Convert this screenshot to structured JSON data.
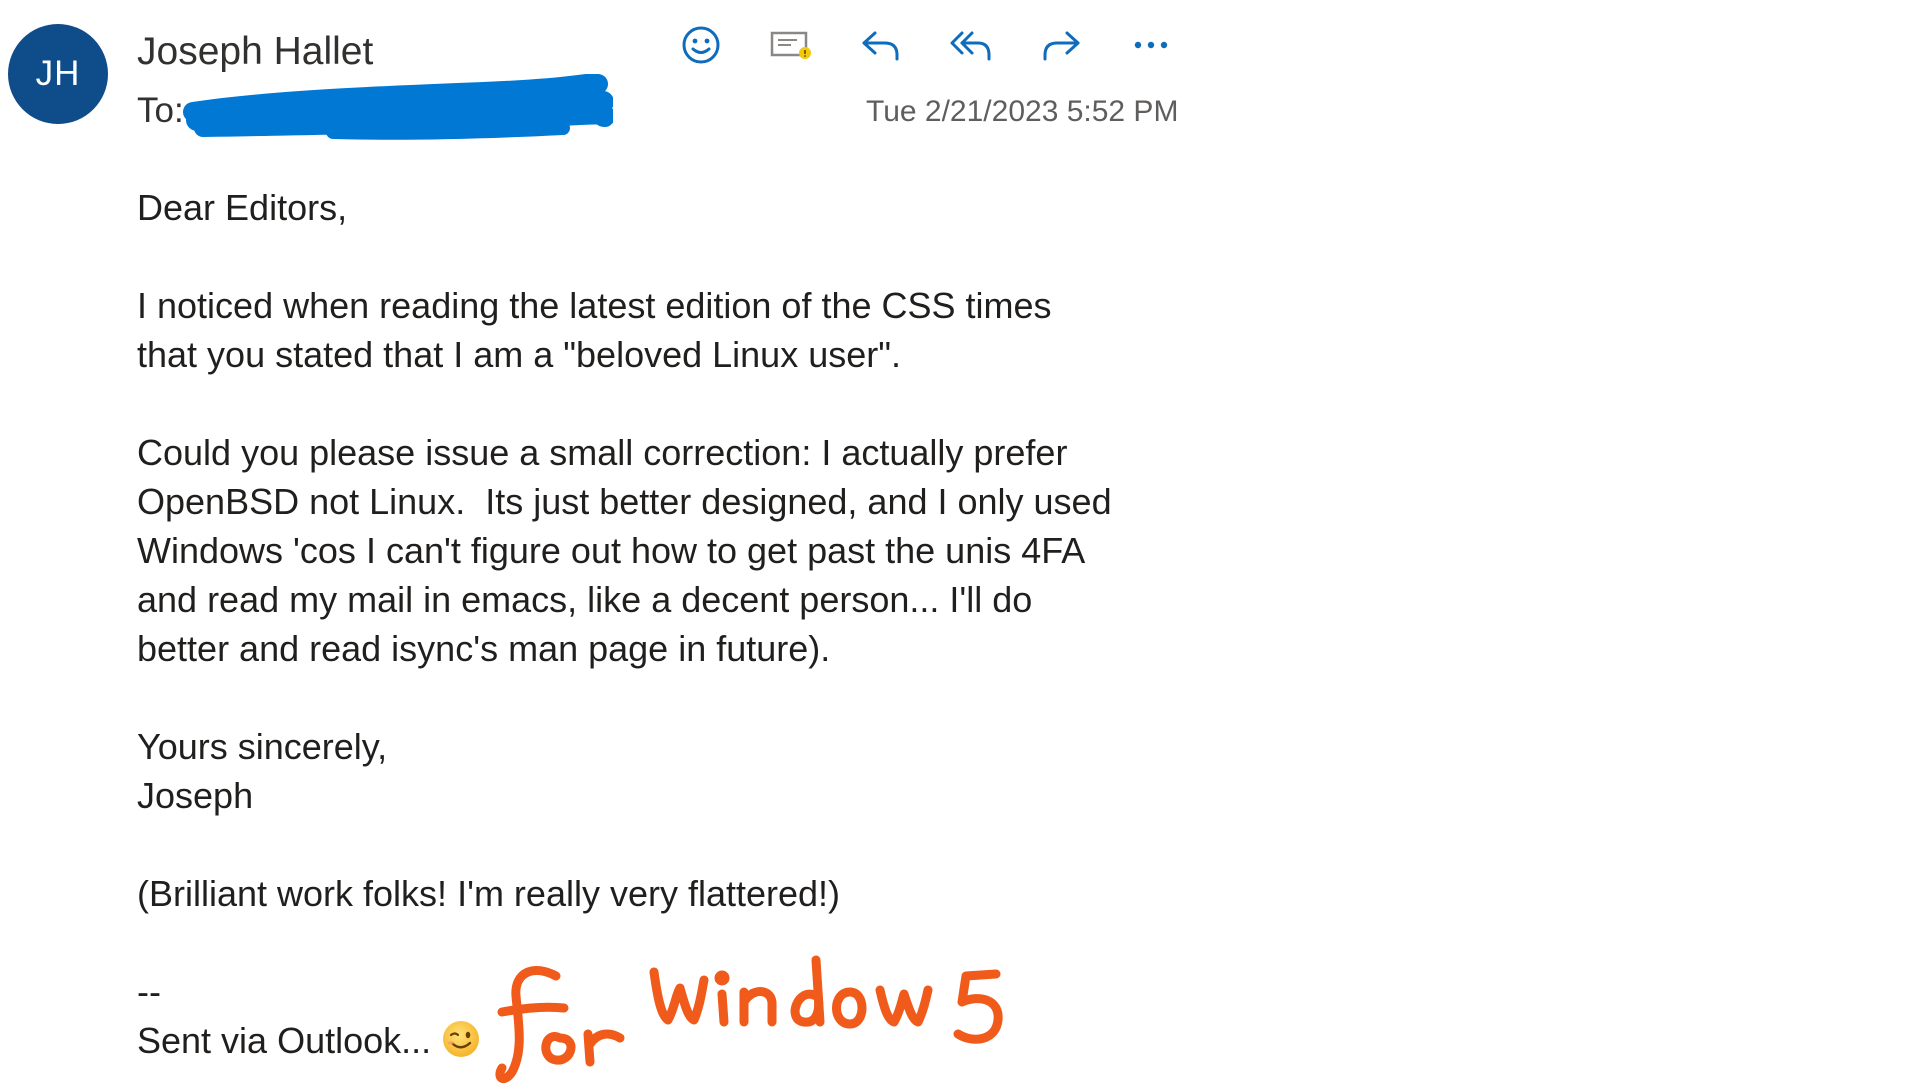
{
  "header": {
    "avatar_initials": "JH",
    "sender_name": "Joseph Hallet",
    "to_label": "To:",
    "timestamp": "Tue 2/21/2023 5:52 PM"
  },
  "toolbar": {
    "actions": [
      {
        "name": "react",
        "icon": "smiley-icon"
      },
      {
        "name": "read-receipt",
        "icon": "envelope-icon"
      },
      {
        "name": "reply",
        "icon": "reply-icon"
      },
      {
        "name": "reply-all",
        "icon": "reply-all-icon"
      },
      {
        "name": "forward",
        "icon": "forward-icon"
      },
      {
        "name": "more",
        "icon": "more-icon"
      }
    ],
    "accent_color": "#0f6cbd"
  },
  "message": {
    "greeting": "Dear Editors,",
    "para1": [
      "I noticed when reading the latest edition of the CSS times",
      "that you stated that I am a \"beloved Linux user\"."
    ],
    "para2": [
      "Could you please issue a small correction: I actually prefer",
      "OpenBSD not Linux.  Its just better designed, and I only used",
      "Windows 'cos I can't figure out how to get past the unis 4FA",
      "and read my mail in emacs, like a decent person... I'll do",
      "better and read isync's man page in future)."
    ],
    "signoff": [
      "Yours sincerely,",
      "Joseph"
    ],
    "postscript": "(Brilliant work folks! I'm really very flattered!)",
    "sig_separator": "--",
    "signature": "Sent via Outlook...",
    "signature_emoji": "winking-face-icon"
  },
  "annotation": {
    "handwritten_text": "for windows",
    "color": "#f05a1a"
  },
  "redaction_color": "#0078d4"
}
